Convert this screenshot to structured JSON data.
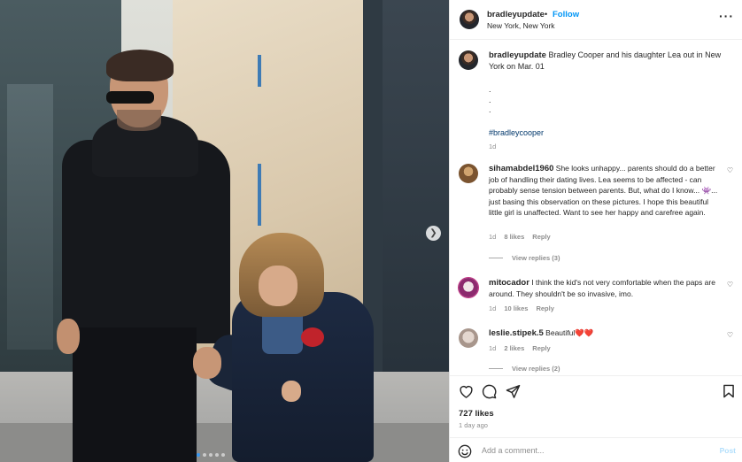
{
  "post": {
    "username": "bradleyupdate",
    "separator": "•",
    "follow_label": "Follow",
    "location": "New York, New York",
    "more_icon": "more-horizontal-icon",
    "caption_text": "Bradley Cooper and his daughter Lea out in New York on Mar. 01",
    "caption_dots": [
      ".",
      ".",
      "."
    ],
    "hashtag": "#bradleycooper",
    "caption_time": "1d",
    "likes": "727 likes",
    "posted": "1 day ago",
    "image_count": 5,
    "image_index": 1
  },
  "comments": [
    {
      "username": "sihamabdel1960",
      "text": "She looks unhappy... parents should do a better job of handling their dating lives. Lea seems to be affected - can probably sense tension between parents. But, what do I know... 👾... just basing this observation on these pictures. I hope this beautiful little girl is unaffected. Want to see her happy and carefree again.",
      "time": "1d",
      "likes": "8 likes",
      "reply_label": "Reply",
      "view_replies": "View replies (3)"
    },
    {
      "username": "mitocador",
      "text": "I think the kid's not very comfortable when the paps are around. They shouldn't be so invasive, imo.",
      "time": "1d",
      "likes": "10 likes",
      "reply_label": "Reply"
    },
    {
      "username": "leslie.stipek.5",
      "text": "Beautiful❤️❤️",
      "time": "1d",
      "likes": "2 likes",
      "reply_label": "Reply",
      "view_replies": "View replies (2)"
    }
  ],
  "composer": {
    "placeholder": "Add a comment...",
    "post_label": "Post"
  },
  "colors": {
    "accent": "#0095f6",
    "hashtag": "#00376b",
    "muted": "#8e8e8e",
    "heart_red": "#ed4956"
  }
}
